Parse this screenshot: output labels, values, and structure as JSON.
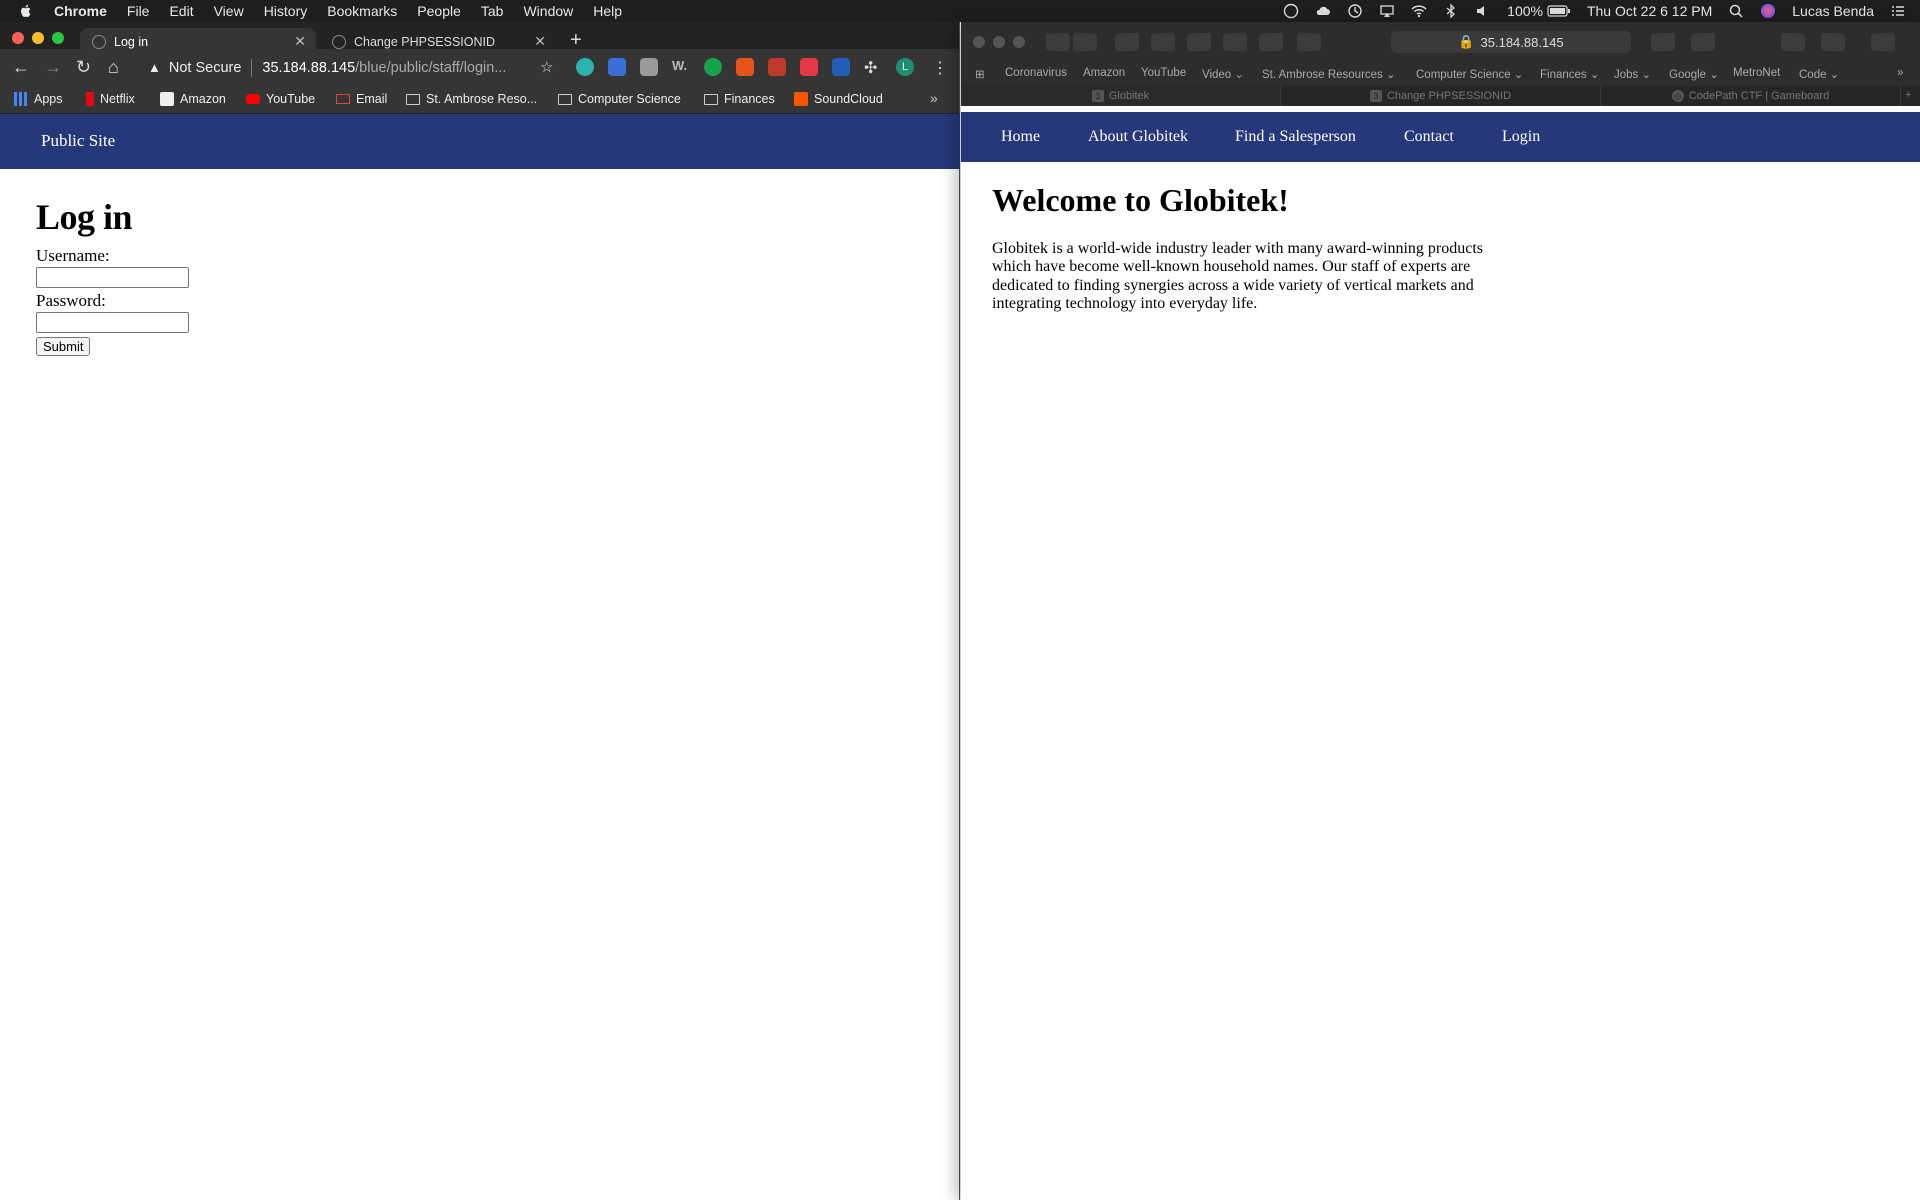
{
  "menubar": {
    "app": "Chrome",
    "items": [
      "File",
      "Edit",
      "View",
      "History",
      "Bookmarks",
      "People",
      "Tab",
      "Window",
      "Help"
    ],
    "battery": "100%",
    "datetime": "Thu Oct 22  6 12 PM",
    "user": "Lucas Benda"
  },
  "chrome": {
    "tabs": [
      {
        "title": "Log in"
      },
      {
        "title": "Change PHPSESSIONID"
      }
    ],
    "omnibox": {
      "security": "Not Secure",
      "host": "35.184.88.145",
      "path": "/blue/public/staff/login..."
    },
    "profile_initial": "L",
    "bookmarks": [
      "Apps",
      "Netflix",
      "Amazon",
      "YouTube",
      "Email",
      "St. Ambrose Reso...",
      "Computer Science",
      "Finances",
      "SoundCloud"
    ],
    "bookmarks_more": "»"
  },
  "staff_page": {
    "header_link": "Public Site",
    "heading": "Log in",
    "username_label": "Username:",
    "password_label": "Password:",
    "submit_label": "Submit"
  },
  "safari": {
    "address": "35.184.88.145",
    "favorites": [
      "Coronavirus",
      "Amazon",
      "YouTube",
      "Video ⌄",
      "St. Ambrose Resources ⌄",
      "Computer Science ⌄",
      "Finances ⌄",
      "Jobs ⌄",
      "Google ⌄",
      "MetroNet",
      "Code ⌄"
    ],
    "tabs": [
      {
        "title": "Globitek"
      },
      {
        "title": "Change PHPSESSIONID"
      },
      {
        "title": "CodePath CTF | Gameboard"
      }
    ],
    "nav": [
      "Home",
      "About Globitek",
      "Find a Salesperson",
      "Contact",
      "Login"
    ],
    "heading": "Welcome to Globitek!",
    "body": "Globitek is a world-wide industry leader with many award-winning products which have become well-known household names. Our staff of experts are dedicated to finding synergies across a wide variety of vertical markets and integrating technology into everyday life."
  }
}
